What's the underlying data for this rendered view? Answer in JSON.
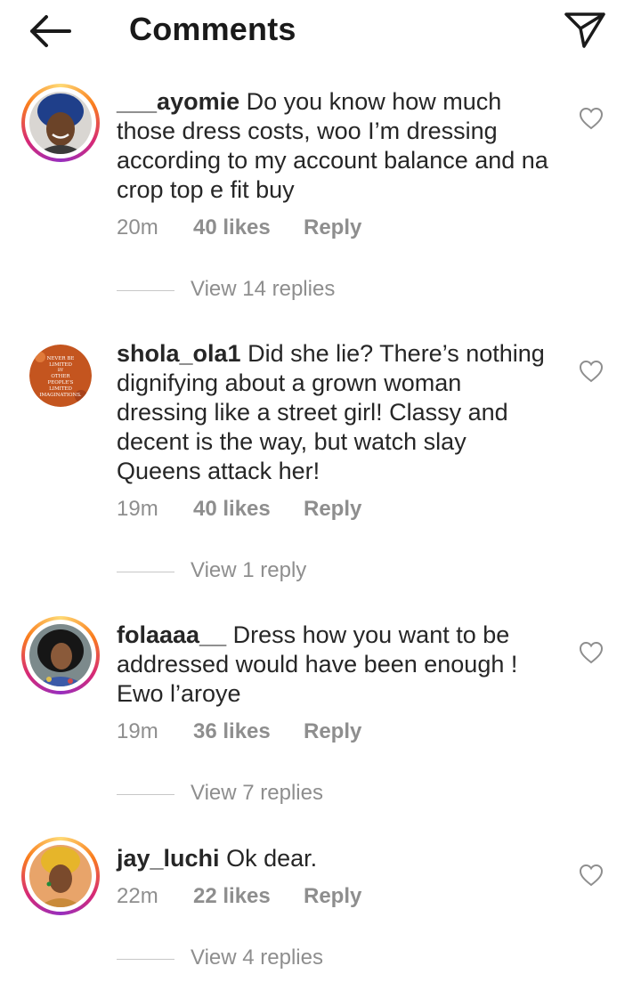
{
  "header": {
    "title": "Comments",
    "back_icon": "arrow-left-icon",
    "send_icon": "paper-plane-icon"
  },
  "comments": [
    {
      "username": "___ayomie",
      "text": "Do you know how much those dress costs, woo I’m dressing according to my account balance and na crop top e fit buy",
      "time": "20m",
      "likes": "40 likes",
      "reply": "Reply",
      "view_replies": "View 14 replies"
    },
    {
      "username": "shola_ola1",
      "text": "Did she lie? There’s nothing dignifying about a grown woman dressing like a street girl! Classy and decent is the way, but watch slay Queens attack her!",
      "time": "19m",
      "likes": "40 likes",
      "reply": "Reply",
      "view_replies": "View 1 reply",
      "avatar_text": [
        "NEVER BE",
        "LIMITED",
        "BY",
        "OTHER",
        "PEOPLE'S",
        "LIMITED",
        "IMAGINATIONS."
      ]
    },
    {
      "username": "folaaaa__",
      "text": "Dress how you want to be addressed would have been enough ! Ewo l’aroye",
      "time": "19m",
      "likes": "36 likes",
      "reply": "Reply",
      "view_replies": "View 7 replies"
    },
    {
      "username": "jay_luchi",
      "text": "Ok dear.",
      "time": "22m",
      "likes": "22 likes",
      "reply": "Reply",
      "view_replies": "View 4 replies"
    }
  ],
  "colors": {
    "text": "#262626",
    "muted": "#8e8e8e",
    "divider": "#c7c7c7",
    "story_ring": [
      "#feda75",
      "#fa7e1e",
      "#d62976",
      "#962fbf"
    ]
  }
}
